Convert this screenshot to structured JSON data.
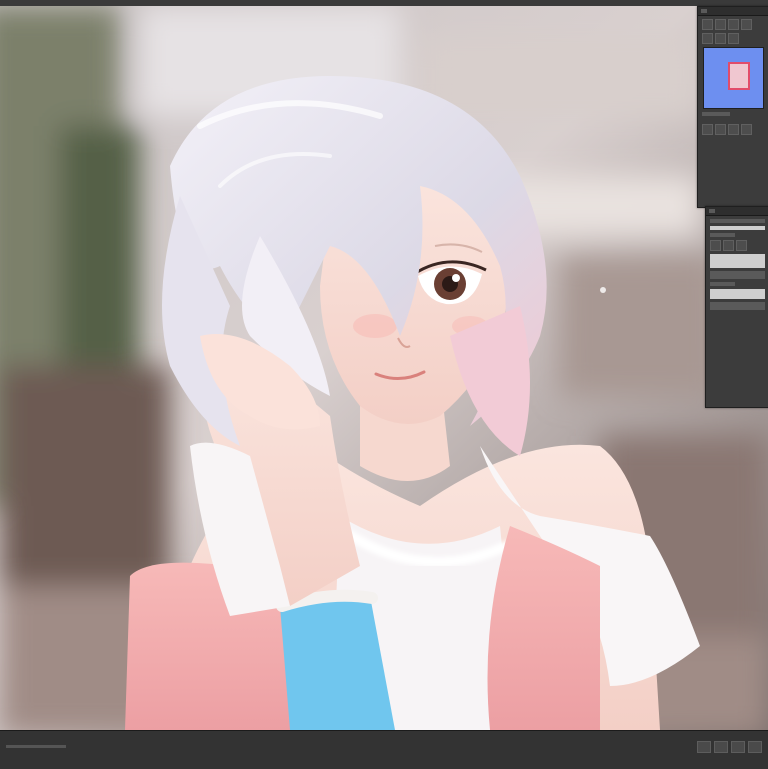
{
  "app": {
    "title": ""
  },
  "status_bar": {
    "zoom": "",
    "info": ""
  },
  "panels": {
    "navigator": {
      "title": "",
      "tools": [
        "",
        "",
        "",
        "",
        "",
        "",
        "",
        ""
      ]
    },
    "layers": {
      "title": "",
      "layers": [
        "",
        "",
        ""
      ]
    }
  },
  "colors": {
    "ui_dark": "#2b2b2b",
    "panel_bg": "#3c3c3c",
    "preview_blue": "#6d8ff0",
    "preview_frame": "#e24c6a",
    "hair": "#eceaf3",
    "jacket": "#f3a7a9",
    "sleeve_blue": "#70c6ee"
  },
  "icons": [
    "navigator-icon",
    "layers-icon",
    "zoom-icon",
    "hand-icon",
    "eye-icon",
    "brush-icon"
  ]
}
